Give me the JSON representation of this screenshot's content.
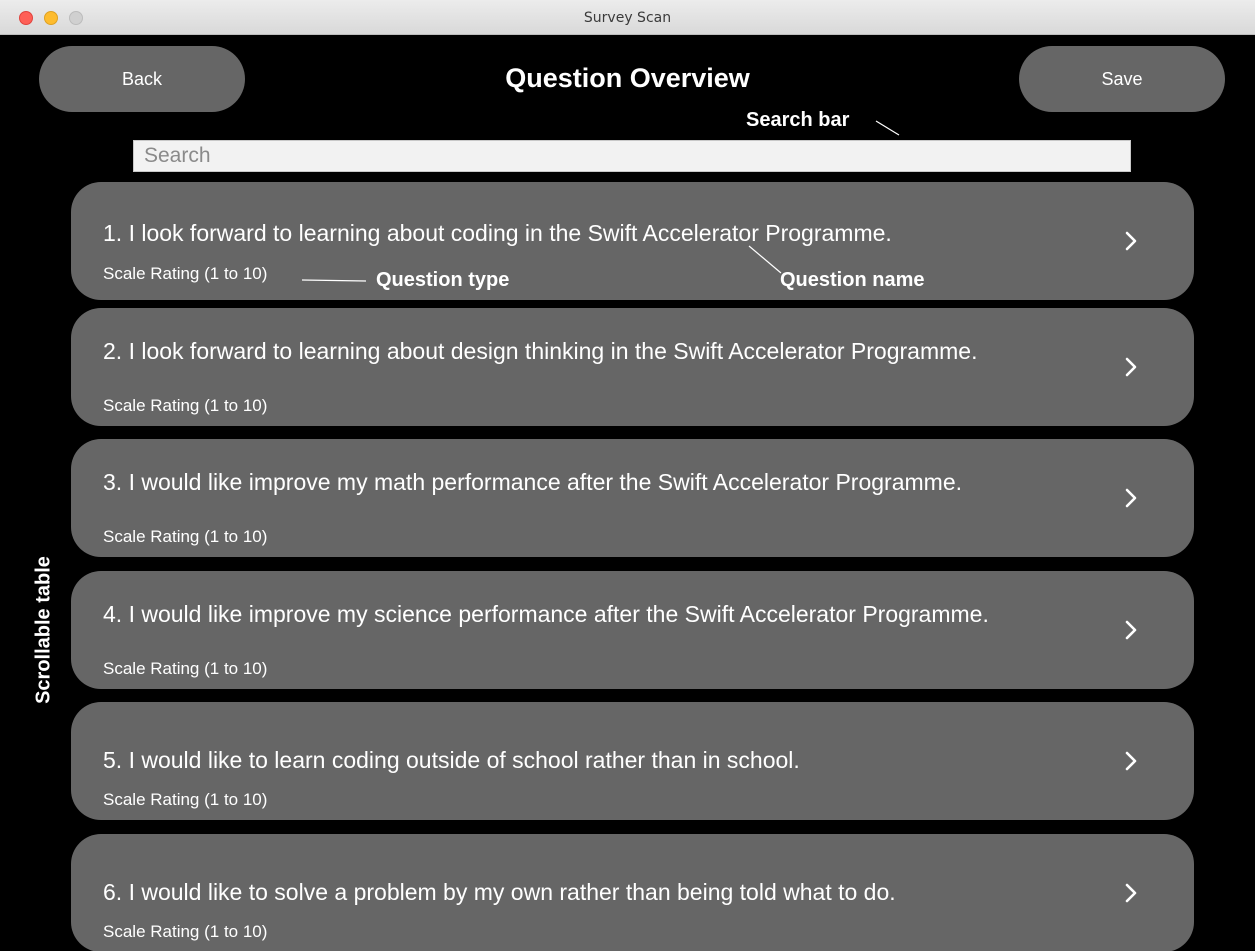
{
  "window": {
    "title": "Survey Scan"
  },
  "header": {
    "back_label": "Back",
    "title": "Question Overview",
    "save_label": "Save"
  },
  "search": {
    "placeholder": "Search",
    "value": ""
  },
  "annotations": {
    "search_bar": "Search bar",
    "question_type": "Question type",
    "question_name": "Question name",
    "scrollable_table": "Scrollable table"
  },
  "questions": [
    {
      "name": "1. I look forward to learning about coding in the Swift Accelerator Programme.",
      "type": "Scale Rating (1 to 10)"
    },
    {
      "name": "2. I look forward to learning about design thinking in the Swift Accelerator Programme.",
      "type": "Scale Rating (1 to 10)"
    },
    {
      "name": "3. I would like improve my math performance after the Swift Accelerator Programme.",
      "type": "Scale Rating (1 to 10)"
    },
    {
      "name": "4. I would like improve my science performance after the Swift Accelerator Programme.",
      "type": "Scale Rating (1 to 10)"
    },
    {
      "name": "5. I would like to learn coding outside of school rather than in school.",
      "type": "Scale Rating (1 to 10)"
    },
    {
      "name": "6. I would like to solve a problem by my own rather than being told what to do.",
      "type": "Scale Rating (1 to 10)"
    }
  ],
  "icons": {
    "row_disclosure": "chevron-right-icon"
  },
  "colors": {
    "background": "#000000",
    "row": "#666666",
    "button": "#666666",
    "text": "#ffffff"
  }
}
